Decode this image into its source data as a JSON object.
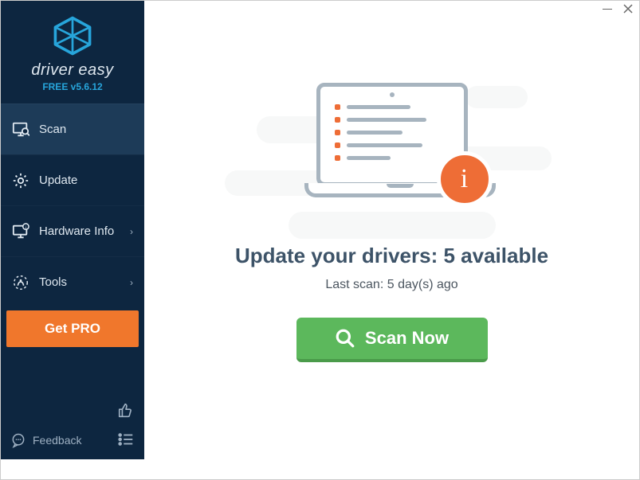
{
  "brand": {
    "name": "driver easy",
    "version": "FREE v5.6.12"
  },
  "sidebar": {
    "items": [
      {
        "label": "Scan",
        "active": true,
        "has_children": false
      },
      {
        "label": "Update",
        "active": false,
        "has_children": false
      },
      {
        "label": "Hardware Info",
        "active": false,
        "has_children": true
      },
      {
        "label": "Tools",
        "active": false,
        "has_children": true
      }
    ],
    "get_pro_label": "Get PRO",
    "feedback_label": "Feedback"
  },
  "main": {
    "headline_prefix": "Update your drivers: ",
    "available_count": 5,
    "headline_suffix": " available",
    "last_scan_prefix": "Last scan: ",
    "last_scan_value": "5 day(s) ago",
    "scan_button_label": "Scan Now"
  },
  "colors": {
    "sidebar_bg": "#0d2640",
    "sidebar_active": "#1d3b58",
    "accent_orange": "#f0772c",
    "accent_green": "#5cb85c",
    "accent_blue": "#27a5db",
    "text_heading": "#3d5368"
  }
}
